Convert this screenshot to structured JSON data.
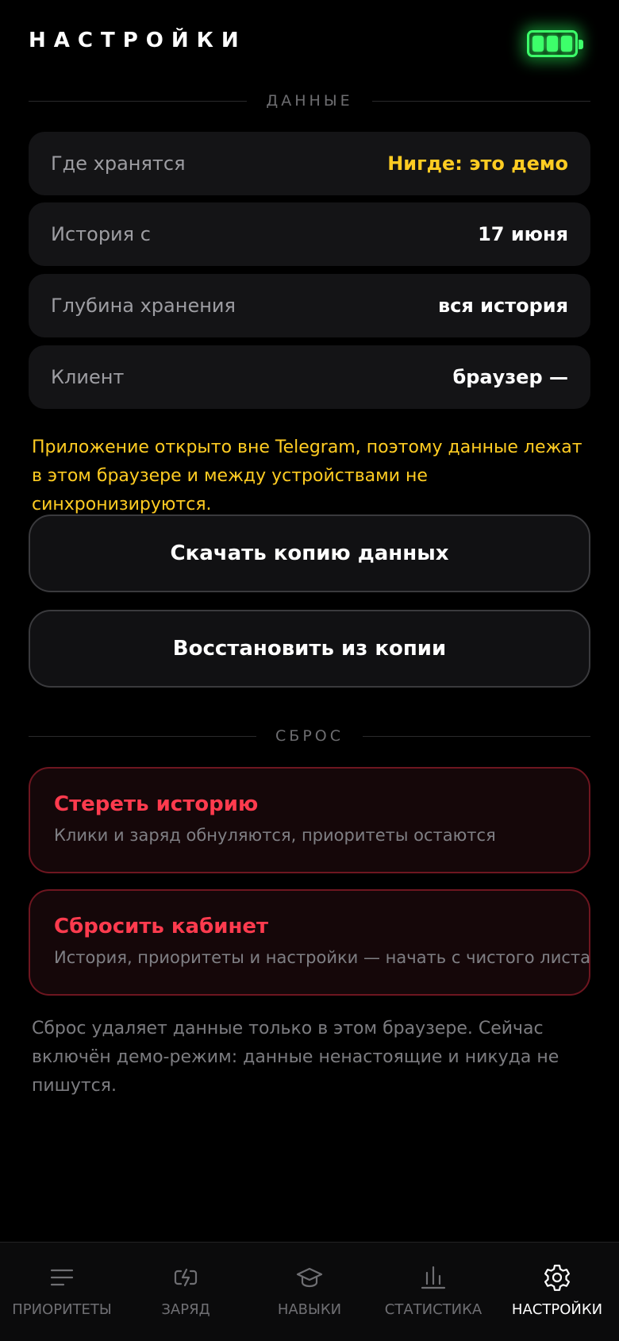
{
  "header": {
    "title": "НАСТРОЙКИ",
    "battery_icon": "battery-full-icon",
    "accent": "#3dff6a"
  },
  "data_section": {
    "label": "ДАННЫЕ",
    "rows": [
      {
        "key": "Где хранятся",
        "value": "Нигде: это демо"
      },
      {
        "key": "История с",
        "value": "17 июня"
      },
      {
        "key": "Глубина хранения",
        "value": "вся история"
      },
      {
        "key": "Клиент",
        "value": "браузер —"
      }
    ],
    "notice": "Приложение открыто вне Telegram, поэтому данные лежат в этом браузере и между устройствами не синхронизируются.",
    "download_label": "Скачать копию данных",
    "restore_label": "Восстановить из копии"
  },
  "reset_section": {
    "label": "СБРОС",
    "clear": {
      "title": "Стереть историю",
      "subtitle": "Клики и заряд обнуляются, приоритеты остаются"
    },
    "reset": {
      "title": "Сбросить кабинет",
      "subtitle": "История, приоритеты и настройки — начать с чистого листа"
    },
    "footnote": "Сброс удаляет данные только в этом браузере. Сейчас включён демо-режим: данные ненастоящие и никуда не пишутся."
  },
  "colors": {
    "warning": "#ffcc22",
    "danger": "#ff3b4e"
  },
  "tabs": [
    {
      "label": "ПРИОРИТЕТЫ",
      "icon": "list-icon"
    },
    {
      "label": "ЗАРЯД",
      "icon": "charge-icon"
    },
    {
      "label": "НАВЫКИ",
      "icon": "graduation-cap-icon"
    },
    {
      "label": "СТАТИСТИКА",
      "icon": "bar-chart-icon"
    },
    {
      "label": "НАСТРОЙКИ",
      "icon": "gear-icon",
      "active": true
    }
  ]
}
